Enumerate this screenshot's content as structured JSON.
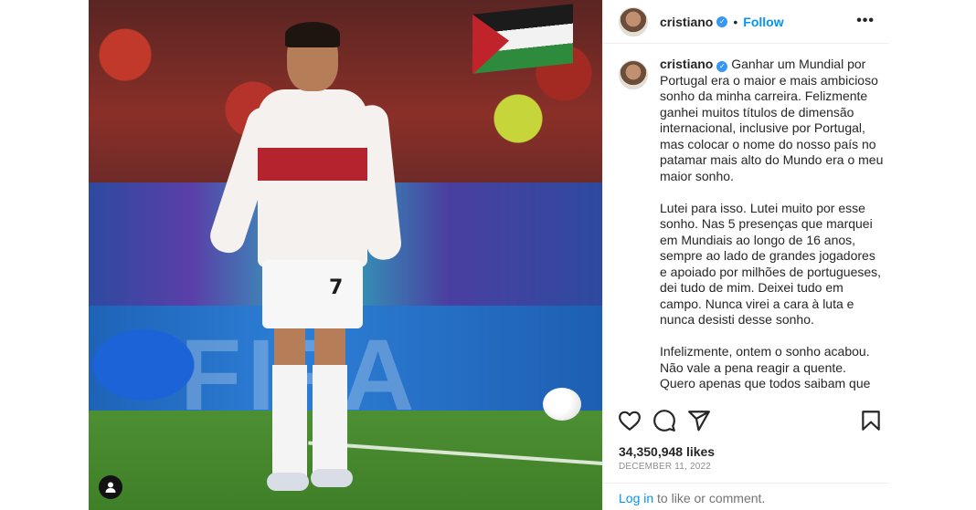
{
  "post": {
    "username": "cristiano",
    "verified_icon": "verified-badge-icon",
    "follow_label": "Follow",
    "more_icon": "more-options-icon",
    "more_label": "•••"
  },
  "media": {
    "jersey_number": "7",
    "board_text": "FIFA",
    "tag_icon": "user-tag-icon"
  },
  "caption": {
    "username": "cristiano",
    "text": "Ganhar um Mundial por Portugal era o maior e mais ambicioso sonho da minha carreira. Felizmente ganhei muitos títulos de dimensão internacional, inclusive por Portugal, mas colocar o nome do nosso país no patamar mais alto do Mundo era o meu maior sonho.\n\nLutei para isso. Lutei muito por esse sonho. Nas 5 presenças que marquei em Mundiais ao longo de 16 anos, sempre ao lado de grandes jogadores e apoiado por milhões de portugueses, dei tudo de mim. Deixei tudo em campo. Nunca virei a cara à luta e nunca desisti desse sonho.\n\nInfelizmente, ontem o sonho acabou. Não vale a pena reagir a quente. Quero apenas que todos saibam que muito se disse, muito se escreveu..."
  },
  "actions": {
    "like_icon": "heart-icon",
    "comment_icon": "comment-icon",
    "share_icon": "share-icon",
    "save_icon": "bookmark-icon"
  },
  "stats": {
    "likes": "34,350,948 likes",
    "date": "DECEMBER 11, 2022"
  },
  "footer": {
    "login_link": "Log in",
    "login_rest": " to like or comment."
  },
  "colors": {
    "accent": "#0095f6",
    "verified": "#3897f0",
    "text": "#262626",
    "muted": "#8e8e8e"
  }
}
